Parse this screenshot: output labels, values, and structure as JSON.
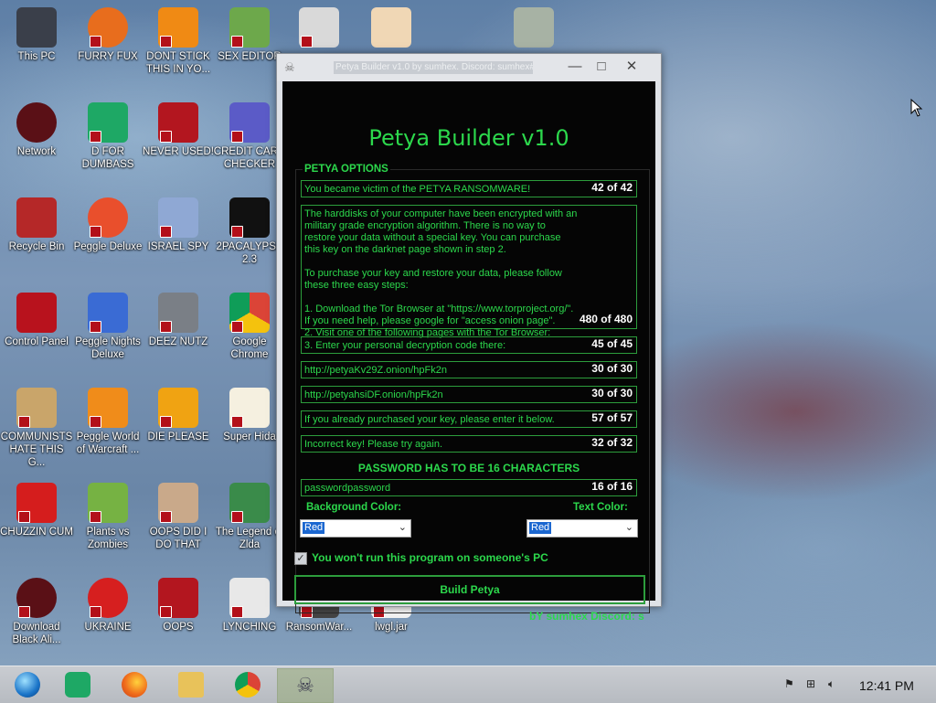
{
  "desktop": {
    "icons": [
      {
        "label": "This PC",
        "icon": "computer-icon"
      },
      {
        "label": "FURRY FUX",
        "icon": "firefox-icon"
      },
      {
        "label": "DONT STICK THIS IN YO...",
        "icon": "vlc-icon"
      },
      {
        "label": "SEX EDITOR",
        "icon": "hxd-icon"
      },
      {
        "label": "",
        "icon": "pixel-app-icon"
      },
      {
        "label": "",
        "icon": "doctor-icon"
      },
      {
        "label": "",
        "icon": "skull-icon"
      },
      {
        "label": "Network",
        "icon": "network-icon"
      },
      {
        "label": "D FOR DUMBASS",
        "icon": "docs-icon"
      },
      {
        "label": "NEVER USED!",
        "icon": "devcpp-icon"
      },
      {
        "label": "CREDIT CARD CHECKER",
        "icon": "credit-card-icon"
      },
      {
        "label": "Recycle Bin",
        "icon": "recycle-bin-icon"
      },
      {
        "label": "Peggle Deluxe",
        "icon": "peggle-icon"
      },
      {
        "label": "ISRAEL SPY",
        "icon": "spy-icon"
      },
      {
        "label": "2PACALYPSE 2.3",
        "icon": "terminal-icon"
      },
      {
        "label": "Control Panel",
        "icon": "control-panel-icon"
      },
      {
        "label": "Peggle Nights Deluxe",
        "icon": "peggle-nights-icon"
      },
      {
        "label": "DEEZ NUTZ",
        "icon": "windows-stack-icon"
      },
      {
        "label": "Google Chrome",
        "icon": "chrome-icon"
      },
      {
        "label": "COMMUNISTS HATE THIS G...",
        "icon": "money-bag-icon"
      },
      {
        "label": "Peggle World of Warcraft ...",
        "icon": "peggle-wow-icon"
      },
      {
        "label": "DIE PLEASE",
        "icon": "de-icon"
      },
      {
        "label": "Super Hida",
        "icon": "pixel-dog-icon"
      },
      {
        "label": "CHUZZIN CUM",
        "icon": "chuzzle-icon"
      },
      {
        "label": "Plants vs Zombies",
        "icon": "plants-icon"
      },
      {
        "label": "OOPS DID I DO THAT",
        "icon": "portrait-icon"
      },
      {
        "label": "The Legend of Zlda",
        "icon": "zelda-icon"
      },
      {
        "label": "Download Black Ali...",
        "icon": "download-icon"
      },
      {
        "label": "UKRAINE",
        "icon": "radiation-icon"
      },
      {
        "label": "OOPS",
        "icon": "oops-icon"
      },
      {
        "label": "LYNCHING",
        "icon": "lynching-icon"
      },
      {
        "label": "RansomWar...",
        "icon": "ransomware-icon"
      },
      {
        "label": "lwgl.jar",
        "icon": "jar-icon"
      }
    ]
  },
  "window": {
    "title": "Petya Builder v1.0 by sumhex.  Discord: sumhex#0001",
    "minimize": "—",
    "maximize": "□",
    "close": "✕",
    "heading": "Petya Builder v1.0",
    "group_label": "PETYA OPTIONS",
    "fields": [
      {
        "text": "You became victim of the PETYA RANSOMWARE!",
        "count": "42 of 42"
      },
      {
        "text": "The harddisks of your computer have been encrypted with an military grade encryption algorithm. There is no way to restore your data without a special key. You can purchase this key on the darknet page shown in step 2.\n\nTo purchase your key and restore your data, please follow these three easy steps:\n\n1. Download the Tor Browser at \"https://www.torproject.org/\". If you need help, please google for \"access onion page\".\n2. Visit one of the following pages with the Tor Browser:",
        "count": "480 of 480"
      },
      {
        "text": "3. Enter your personal decryption code there:",
        "count": "45 of 45"
      },
      {
        "text": "http://petyaKv29Z.onion/hpFk2n",
        "count": "30 of 30"
      },
      {
        "text": "http://petyahsiDF.onion/hpFk2n",
        "count": "30 of 30"
      },
      {
        "text": "If you already purchased your key, please enter it below.",
        "count": "57 of 57"
      },
      {
        "text": "Incorrect key! Please try again.",
        "count": "32 of 32"
      }
    ],
    "password_heading": "PASSWORD HAS TO BE 16 CHARACTERS",
    "password": {
      "text": "passwordpassword",
      "count": "16 of 16"
    },
    "background_color_label": "Background Color:",
    "text_color_label": "Text Color:",
    "background_color_value": "Red",
    "text_color_value": "Red",
    "checkbox_label": "You won't run this program on someone's PC",
    "checkbox_checked": true,
    "build_button": "Build Petya",
    "footer": "bY sumhex    Discord: s"
  },
  "taskbar": {
    "apps": [
      "start-orb-icon",
      "docs-icon",
      "firefox-icon",
      "file-explorer-icon",
      "chrome-icon",
      "skull-icon"
    ],
    "clock": "12:41 PM"
  },
  "colors": {
    "accent_green": "#2cd84c",
    "window_bg": "#050505",
    "taskbar": "#c4c7cc"
  }
}
